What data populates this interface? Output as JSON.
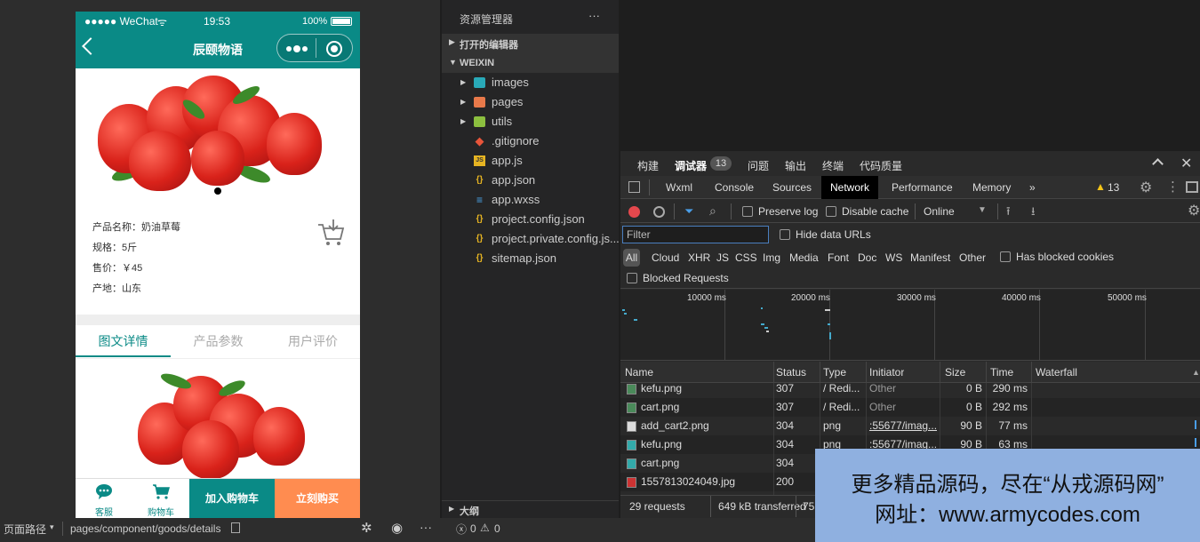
{
  "phone": {
    "status": {
      "carrier": "●●●●● WeChat",
      "wifi": "ᯤ",
      "time": "19:53",
      "battery": "100%"
    },
    "nav": {
      "back_icon": "chevron-left",
      "title": "辰颐物语"
    },
    "product": {
      "name": "产品名称：奶油草莓",
      "spec": "规格：5斤",
      "price": "售价：￥45",
      "origin": "产地：山东"
    },
    "tabs": [
      {
        "label": "图文详情",
        "active": true
      },
      {
        "label": "产品参数",
        "active": false
      },
      {
        "label": "用户评价",
        "active": false
      }
    ],
    "bottom": {
      "service": "客服",
      "cart": "购物车",
      "add_cart": "加入购物车",
      "buy_now": "立刻购买"
    },
    "colors": {
      "teal": "#0a8a86",
      "orange": "#ff8c50"
    }
  },
  "explorer": {
    "title": "资源管理器",
    "more": "···",
    "open_editors": "打开的编辑器",
    "root": "WEIXIN",
    "items": [
      {
        "name": "images",
        "icon": "folder-images-icon",
        "folder": true
      },
      {
        "name": "pages",
        "icon": "folder-pages-icon",
        "folder": true
      },
      {
        "name": "utils",
        "icon": "folder-utils-icon",
        "folder": true
      },
      {
        "name": ".gitignore",
        "icon": "git-icon",
        "folder": false
      },
      {
        "name": "app.js",
        "icon": "js-icon",
        "folder": false
      },
      {
        "name": "app.json",
        "icon": "json-icon",
        "folder": false
      },
      {
        "name": "app.wxss",
        "icon": "css-icon",
        "folder": false
      },
      {
        "name": "project.config.json",
        "icon": "json-icon",
        "folder": false
      },
      {
        "name": "project.private.config.js...",
        "icon": "json-icon",
        "folder": false
      },
      {
        "name": "sitemap.json",
        "icon": "json-icon",
        "folder": false
      }
    ],
    "outline": "大纲",
    "errors": "0",
    "warnings": "0"
  },
  "devtools": {
    "top_tabs": [
      "构建",
      "调试器",
      "问题",
      "输出",
      "终端",
      "代码质量"
    ],
    "debugger_badge": "13",
    "panel_tabs": [
      "Wxml",
      "Console",
      "Sources",
      "Network",
      "Performance",
      "Memory"
    ],
    "more_tabs": "»",
    "warning_count": "13",
    "preserve_log": "Preserve log",
    "disable_cache": "Disable cache",
    "throttle": "Online",
    "filter_placeholder": "Filter",
    "hide_data_urls": "Hide data URLs",
    "type_filters": [
      "All",
      "Cloud",
      "XHR",
      "JS",
      "CSS",
      "Img",
      "Media",
      "Font",
      "Doc",
      "WS",
      "Manifest",
      "Other"
    ],
    "has_blocked_cookies": "Has blocked cookies",
    "blocked_requests": "Blocked Requests",
    "timeline_ticks": [
      "10000 ms",
      "20000 ms",
      "30000 ms",
      "40000 ms",
      "50000 ms"
    ],
    "columns": [
      "Name",
      "Status",
      "Type",
      "Initiator",
      "Size",
      "Time",
      "Waterfall"
    ],
    "rows": [
      {
        "name": "kefu.png",
        "status": "307",
        "type": "/ Redi...",
        "initiator": "Other",
        "size": "0 B",
        "time": "290 ms"
      },
      {
        "name": "cart.png",
        "status": "307",
        "type": "/ Redi...",
        "initiator": "Other",
        "size": "0 B",
        "time": "292 ms"
      },
      {
        "name": "add_cart2.png",
        "status": "304",
        "type": "png",
        "initiator": ":55677/imag...",
        "size": "90 B",
        "time": "77 ms"
      },
      {
        "name": "kefu.png",
        "status": "304",
        "type": "png",
        "initiator": ":55677/imag...",
        "size": "90 B",
        "time": "63 ms"
      },
      {
        "name": "cart.png",
        "status": "304",
        "type": "",
        "initiator": "",
        "size": "",
        "time": ""
      },
      {
        "name": "1557813024049.jpg",
        "status": "200",
        "type": "",
        "initiator": "",
        "size": "",
        "time": ""
      }
    ],
    "summary": {
      "requests": "29 requests",
      "transferred": "649 kB transferred",
      "extra": "75"
    }
  },
  "bottom_bar": {
    "path_label": "页面路径",
    "path_value": "pages/component/goods/details"
  },
  "watermark": {
    "line1": "更多精品源码，尽在“从戎源码网”",
    "line2": "网址：www.armycodes.com"
  }
}
